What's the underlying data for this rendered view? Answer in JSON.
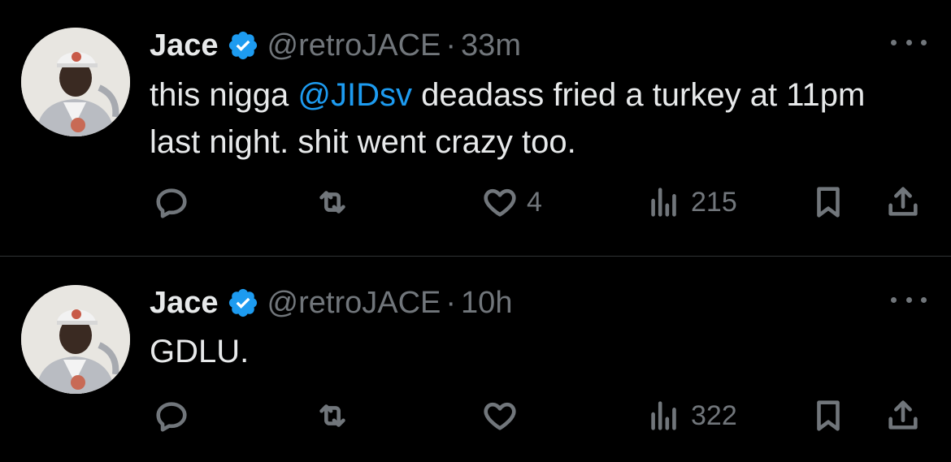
{
  "tweets": [
    {
      "author_name": "Jace",
      "handle": "@retroJACE",
      "separator": "·",
      "time": "33m",
      "text_before": "this nigga ",
      "mention": "@JIDsv",
      "text_after": " deadass fried a turkey at 11pm last night. shit went crazy too.",
      "likes": "4",
      "views": "215"
    },
    {
      "author_name": "Jace",
      "handle": "@retroJACE",
      "separator": "·",
      "time": "10h",
      "text": "GDLU.",
      "likes": "",
      "views": "322"
    }
  ],
  "colors": {
    "background": "#000000",
    "text": "#e7e9ea",
    "secondary": "#71767b",
    "accent": "#1d9bf0",
    "divider": "#2f3336"
  },
  "icons": [
    "verified-badge-icon",
    "more-icon",
    "reply-icon",
    "retweet-icon",
    "like-icon",
    "views-icon",
    "bookmark-icon",
    "share-icon"
  ]
}
